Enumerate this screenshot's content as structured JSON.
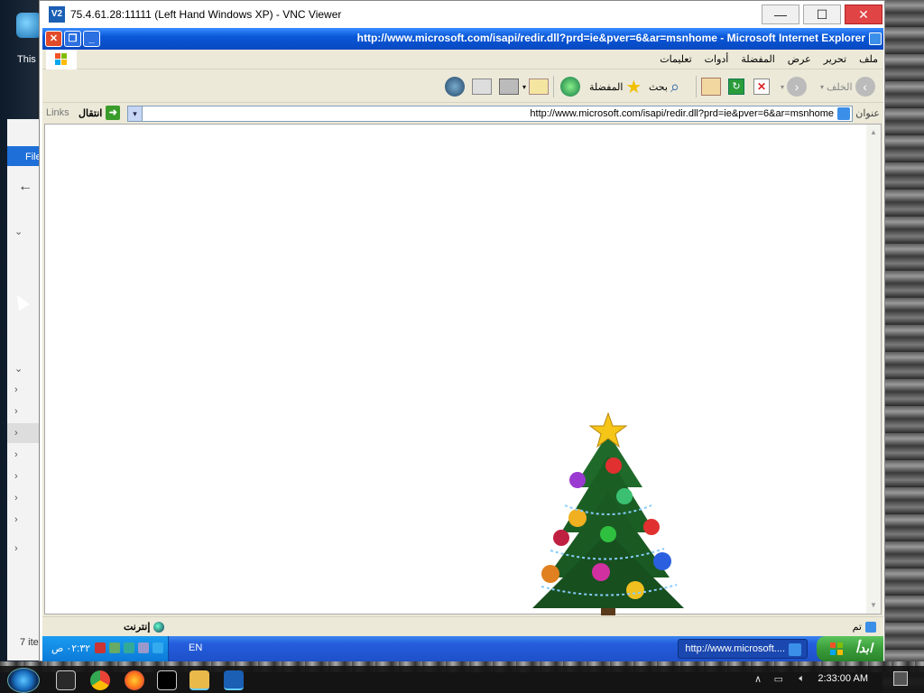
{
  "host": {
    "desktop_icon_label": "This",
    "explorer_tab": "File",
    "items_count": "7 ite",
    "clock": "2:33:00 AM"
  },
  "vnc": {
    "logo": "V2",
    "title": "75.4.61.28:11111 (Left Hand Windows XP) - VNC Viewer",
    "min_label": "—",
    "max_label": "☐",
    "close_label": "✕"
  },
  "ie": {
    "title": "http://www.microsoft.com/isapi/redir.dll?prd=ie&pver=6&ar=msnhome - Microsoft Internet Explorer",
    "menu": [
      "ملف",
      "تحرير",
      "عرض",
      "المفضلة",
      "أدوات",
      "تعليمات"
    ],
    "toolbar": {
      "back": "الخلف",
      "search": "بحث",
      "favorites": "المفضلة"
    },
    "address": {
      "label": "عنوان",
      "url": "http://www.microsoft.com/isapi/redir.dll?prd=ie&pver=6&ar=msnhome",
      "go": "انتقال",
      "links": "Links"
    },
    "status": {
      "done": "تم",
      "zone": "إنترنت"
    }
  },
  "xp_taskbar": {
    "clock": "٠٢:٣٢ ص",
    "lang": "EN",
    "task_label": "http://www.microsoft....",
    "start_label": "ابدأ"
  }
}
